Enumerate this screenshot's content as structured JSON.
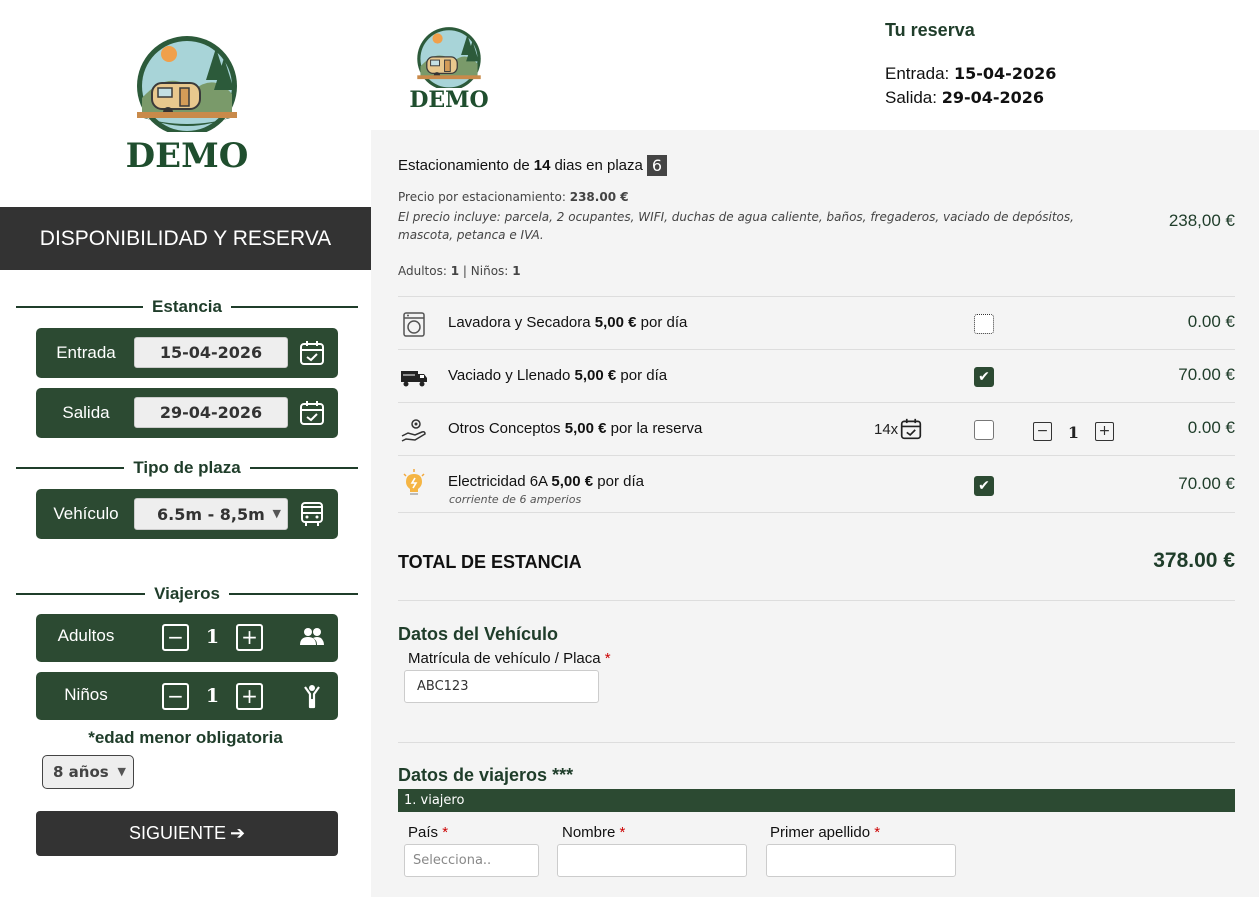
{
  "brand": {
    "logo_text": "DEMO"
  },
  "sidebar": {
    "header": "DISPONIBILIDAD Y RESERVA",
    "stay_title": "Estancia",
    "entry_label": "Entrada",
    "entry_value": "15-04-2026",
    "exit_label": "Salida",
    "exit_value": "29-04-2026",
    "pitch_title": "Tipo de plaza",
    "vehicle_label": "Vehículo",
    "vehicle_value": "6.5m - 8,5m",
    "travelers_title": "Viajeros",
    "adults_label": "Adultos",
    "adults_value": "1",
    "children_label": "Niños",
    "children_value": "1",
    "age_note": "*edad menor obligatoria",
    "age_value": "8 años",
    "next_label": "SIGUIENTE"
  },
  "booking": {
    "title": "Tu reserva",
    "entry_label": "Entrada:",
    "entry_value": "15-04-2026",
    "exit_label": "Salida:",
    "exit_value": "29-04-2026"
  },
  "summary": {
    "parking_pre": "Estacionamiento de",
    "days": "14",
    "parking_mid": "dias en plaza",
    "plaza": "6",
    "price_label": "Precio por estacionamiento:",
    "price_value": "238.00 €",
    "includes": "El precio incluye: parcela, 2 ocupantes, WIFI, duchas de agua caliente, baños, fregaderos, vaciado de depósitos, mascota, petanca e IVA.",
    "base_total": "238,00 €",
    "adults_label": "Adultos:",
    "adults_value": "1",
    "sep": "|",
    "children_label": "Niños:",
    "children_value": "1"
  },
  "extras": [
    {
      "name": "Lavadora y Secadora",
      "price_unit": "5,00 €",
      "per": "por día",
      "checked": false,
      "total": "0.00 €",
      "icon": "washing-machine-icon"
    },
    {
      "name": "Vaciado y Llenado",
      "price_unit": "5,00 €",
      "per": "por día",
      "checked": true,
      "total": "70.00 €",
      "icon": "truck-icon"
    },
    {
      "name": "Otros Conceptos",
      "price_unit": "5,00 €",
      "per": "por la reserva",
      "days": "14x",
      "qty": "1",
      "checked": false,
      "total": "0.00 €",
      "icon": "service-hand-icon"
    },
    {
      "name": "Electricidad 6A",
      "price_unit": "5,00 €",
      "per": "por día",
      "sub": "corriente de 6 amperios",
      "checked": true,
      "total": "70.00 €",
      "icon": "lightbulb-icon"
    }
  ],
  "total": {
    "label": "TOTAL DE ESTANCIA",
    "value": "378.00 €"
  },
  "vehicle_section": {
    "title": "Datos del Vehículo",
    "plate_label": "Matrícula de vehículo / Placa",
    "required_mark": "*",
    "plate_value": "ABC123"
  },
  "travelers_section": {
    "title": "Datos de viajeros ***",
    "traveler_bar": "1. viajero",
    "country_label": "País",
    "country_placeholder": "Selecciona..",
    "name_label": "Nombre",
    "surname_label": "Primer apellido",
    "required_mark": "*"
  },
  "colors": {
    "primary": "#2c4a32",
    "dark": "#333333",
    "accent_text": "#1f3d2a",
    "required": "#cc0000"
  }
}
